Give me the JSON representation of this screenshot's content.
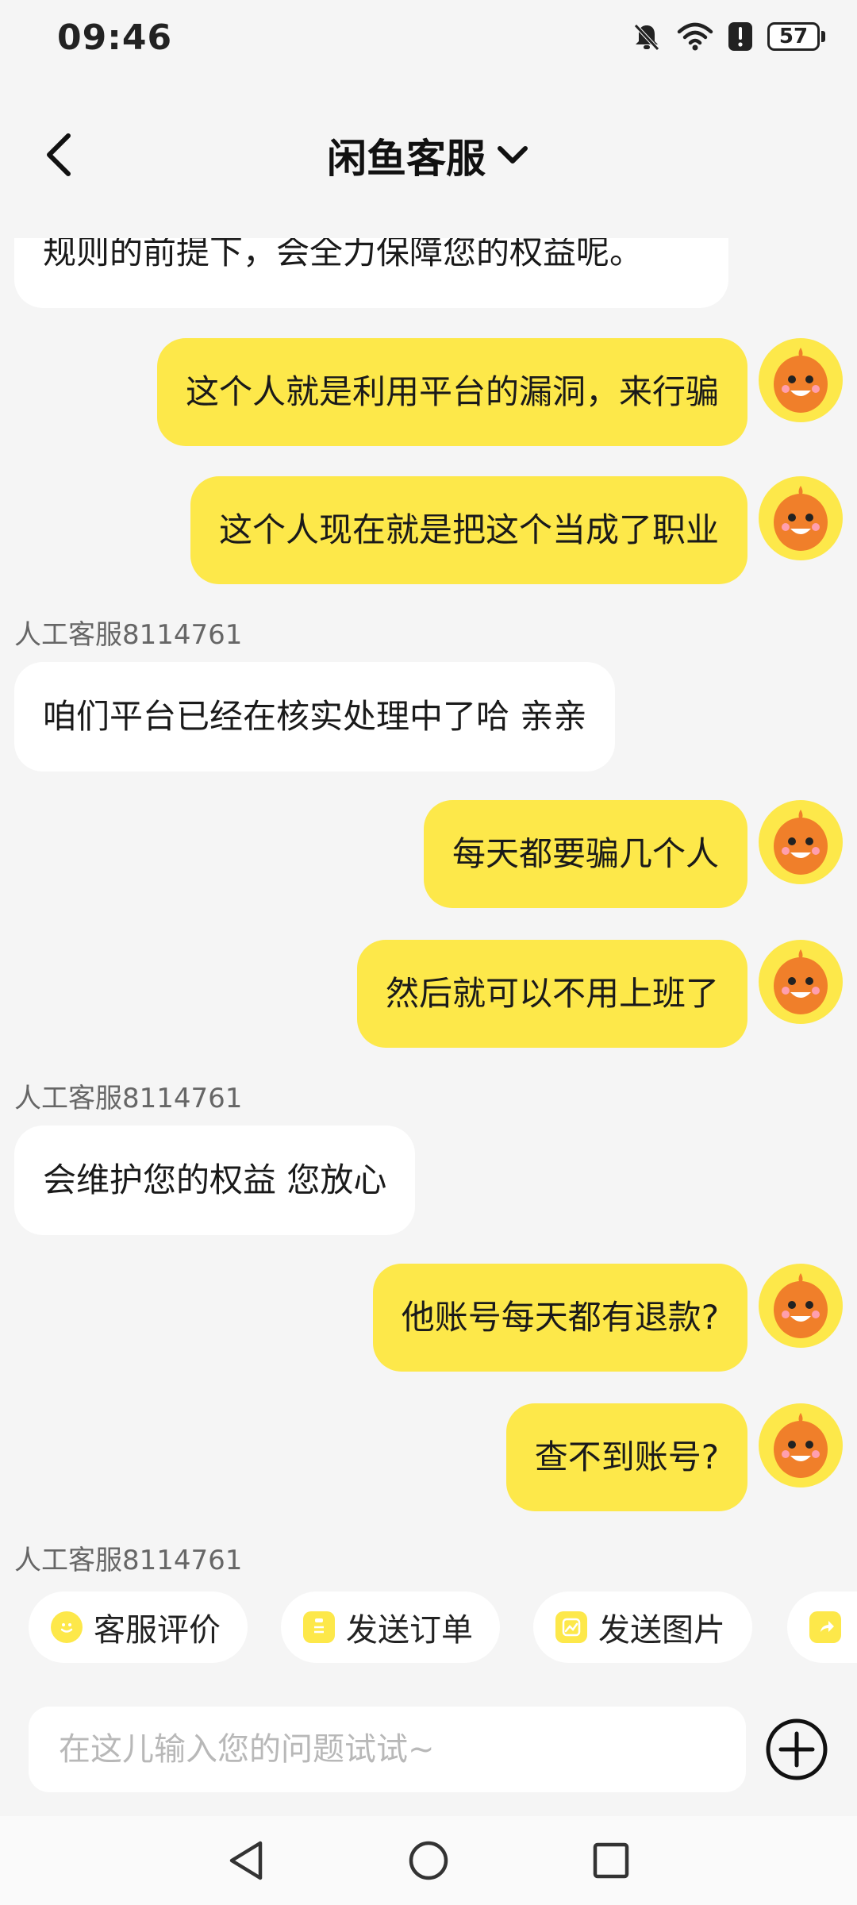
{
  "status_bar": {
    "time": "09:46",
    "battery_level": "57"
  },
  "header": {
    "title": "闲鱼客服"
  },
  "messages": [
    {
      "role": "agent",
      "text": "规则的前提下，会全力保障您的权益呢。"
    },
    {
      "role": "user",
      "text": "这个人就是利用平台的漏洞，来行骗"
    },
    {
      "role": "user",
      "text": "这个人现在就是把这个当成了职业"
    },
    {
      "role": "agent_name",
      "text": "人工客服8114761"
    },
    {
      "role": "agent",
      "text": "咱们平台已经在核实处理中了哈 亲亲"
    },
    {
      "role": "user",
      "text": "每天都要骗几个人"
    },
    {
      "role": "user",
      "text": "然后就可以不用上班了"
    },
    {
      "role": "agent_name",
      "text": "人工客服8114761"
    },
    {
      "role": "agent",
      "text": "会维护您的权益 您放心"
    },
    {
      "role": "user",
      "text": "他账号每天都有退款?"
    },
    {
      "role": "user",
      "text": "查不到账号?"
    },
    {
      "role": "agent_name",
      "text": "人工客服8114761"
    }
  ],
  "quick_actions": [
    {
      "label": "客服评价",
      "icon": "smile-icon"
    },
    {
      "label": "发送订单",
      "icon": "clipboard-icon"
    },
    {
      "label": "发送图片",
      "icon": "image-icon"
    },
    {
      "label": "",
      "icon": "share-icon"
    }
  ],
  "input": {
    "placeholder": "在这儿输入您的问题试试~",
    "value": ""
  },
  "colors": {
    "user_bubble": "#fde84a",
    "agent_bubble": "#ffffff",
    "background": "#f5f5f5",
    "avatar": "#f07f2a"
  }
}
